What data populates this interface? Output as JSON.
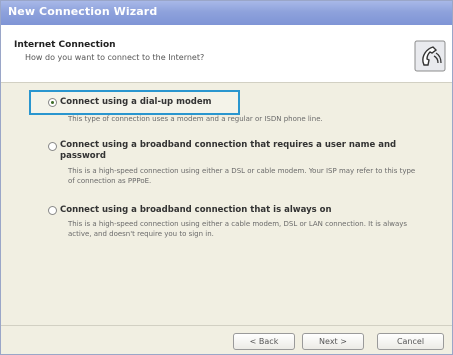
{
  "window": {
    "title": "New Connection Wizard"
  },
  "header": {
    "title": "Internet Connection",
    "subtitle": "How do you want to connect to the Internet?",
    "icon": "phone-connection-icon"
  },
  "options": [
    {
      "label": "Connect using a dial-up modem",
      "description": "This type of connection uses a modem and a regular or ISDN phone line.",
      "selected": true
    },
    {
      "label": "Connect using a broadband connection that requires a user name and password",
      "description": "This is a high-speed connection using either a DSL or cable modem. Your ISP may refer to this type of connection as PPPoE.",
      "selected": false
    },
    {
      "label": "Connect using a broadband connection that is always on",
      "description": "This is a high-speed connection using either a cable modem, DSL or LAN connection. It is always active, and doesn't require you to sign in.",
      "selected": false
    }
  ],
  "buttons": {
    "back": "< Back",
    "next": "Next >",
    "cancel": "Cancel"
  },
  "colors": {
    "titlebar": "#8ea2dc",
    "highlight": "#2a96cf"
  }
}
